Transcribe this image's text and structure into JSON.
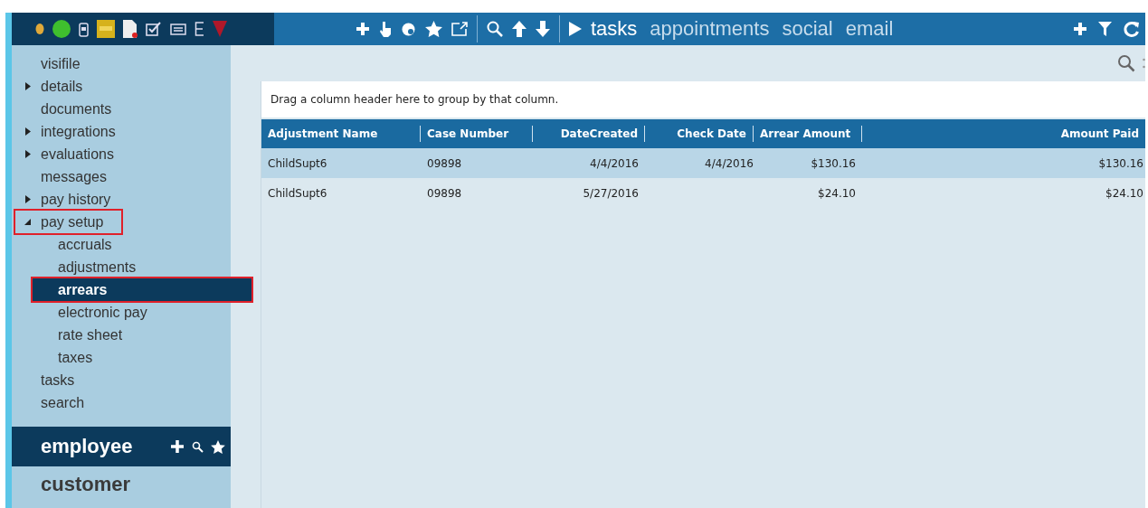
{
  "toolbar": {
    "tabs": [
      {
        "label": "tasks",
        "selected": true
      },
      {
        "label": "appointments",
        "selected": false
      },
      {
        "label": "social",
        "selected": false
      },
      {
        "label": "email",
        "selected": false
      }
    ]
  },
  "sidebar": {
    "items": [
      {
        "label": "visifile",
        "selected": false,
        "highlighted": false
      },
      {
        "label": "details",
        "expanded": false,
        "selected": false,
        "highlighted": false
      },
      {
        "label": "documents",
        "selected": false,
        "highlighted": false
      },
      {
        "label": "integrations",
        "expanded": false,
        "selected": false,
        "highlighted": false
      },
      {
        "label": "evaluations",
        "expanded": false,
        "selected": false,
        "highlighted": false
      },
      {
        "label": "messages",
        "selected": false,
        "highlighted": false
      },
      {
        "label": "pay history",
        "expanded": false,
        "selected": false,
        "highlighted": false
      },
      {
        "label": "pay setup",
        "expanded": true,
        "selected": false,
        "highlighted": true,
        "children": [
          {
            "label": "accruals",
            "selected": false,
            "highlighted": false
          },
          {
            "label": "adjustments",
            "selected": false,
            "highlighted": false
          },
          {
            "label": "arrears",
            "selected": true,
            "highlighted": true
          },
          {
            "label": "electronic pay",
            "selected": false,
            "highlighted": false
          },
          {
            "label": "rate sheet",
            "selected": false,
            "highlighted": false
          },
          {
            "label": "taxes",
            "selected": false,
            "highlighted": false
          }
        ]
      },
      {
        "label": "tasks",
        "selected": false,
        "highlighted": false
      },
      {
        "label": "search",
        "selected": false,
        "highlighted": false
      }
    ],
    "modules": [
      {
        "label": "employee",
        "selected": true
      },
      {
        "label": "customer",
        "selected": false
      }
    ]
  },
  "grid": {
    "group_hint": "Drag a column header here to group by that column.",
    "columns": [
      "Adjustment Name",
      "Case Number",
      "DateCreated",
      "Check Date",
      "Arrear Amount",
      "Amount Paid"
    ],
    "rows": [
      {
        "selected": true,
        "cells": [
          "ChildSupt6",
          "09898",
          "4/4/2016",
          "4/4/2016",
          "$130.16",
          "$130.16"
        ]
      },
      {
        "selected": false,
        "cells": [
          "ChildSupt6",
          "09898",
          "5/27/2016",
          "",
          "$24.10",
          "$24.10"
        ]
      }
    ]
  }
}
